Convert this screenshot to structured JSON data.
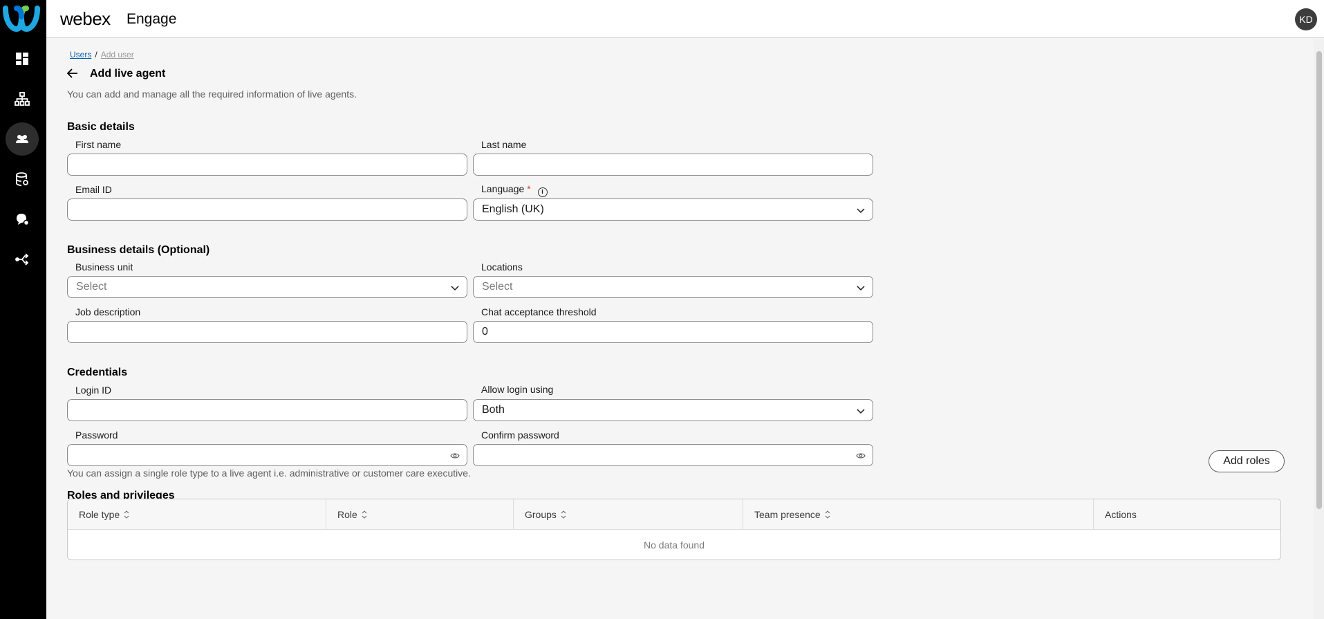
{
  "app": {
    "brand": "webex",
    "product": "Engage",
    "user_initials": "KD"
  },
  "rail": {
    "items": [
      "dashboard-icon",
      "org-chart-icon",
      "users-icon",
      "database-icon",
      "chat-bubbles-icon",
      "routing-icon"
    ],
    "active": "users-icon"
  },
  "breadcrumb": {
    "parent": "Users",
    "current": "Add user"
  },
  "page": {
    "title": "Add live agent",
    "description": "You can add and manage all the required information of live agents."
  },
  "basic": {
    "heading": "Basic details",
    "first_name_label": "First name",
    "first_name_value": "",
    "last_name_label": "Last name",
    "last_name_value": "",
    "email_label": "Email ID",
    "email_value": "",
    "language_label": "Language",
    "language_required": "*",
    "language_value": "English (UK)"
  },
  "business": {
    "heading": "Business details (Optional)",
    "unit_label": "Business unit",
    "unit_placeholder": "Select",
    "locations_label": "Locations",
    "locations_placeholder": "Select",
    "job_label": "Job description",
    "job_value": "",
    "threshold_label": "Chat acceptance threshold",
    "threshold_value": "0"
  },
  "credentials": {
    "heading": "Credentials",
    "login_label": "Login ID",
    "login_value": "",
    "allow_label": "Allow login using",
    "allow_value": "Both",
    "password_label": "Password",
    "password_value": "",
    "confirm_label": "Confirm password",
    "confirm_value": ""
  },
  "roles": {
    "heading": "Roles and privileges",
    "description": "You can assign a single role type to a live agent i.e. administrative or customer care executive.",
    "add_button": "Add roles",
    "columns": [
      "Role type",
      "Role",
      "Groups",
      "Team presence",
      "Actions"
    ],
    "empty_text": "No data found"
  }
}
